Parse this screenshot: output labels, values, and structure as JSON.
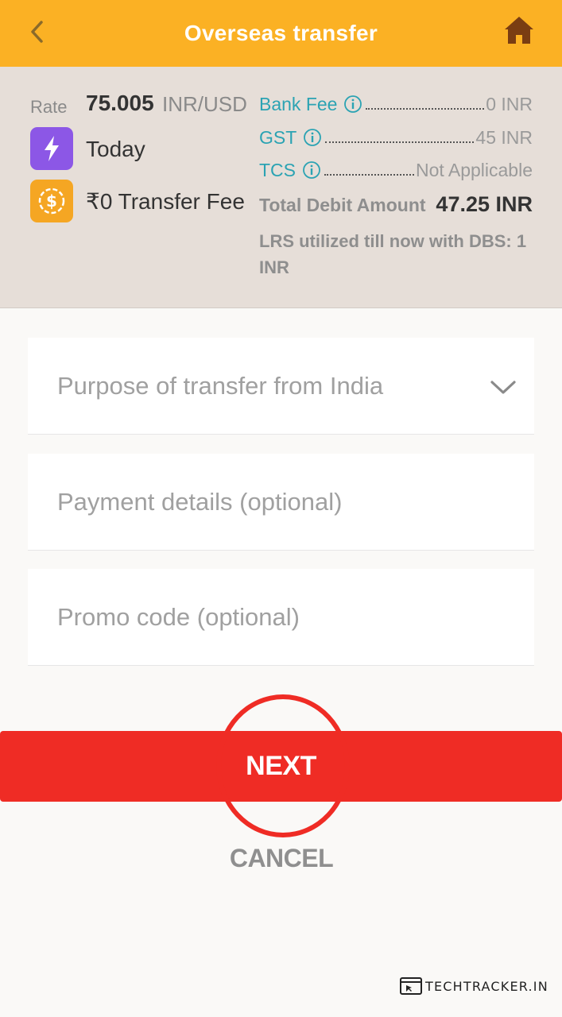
{
  "header": {
    "title": "Overseas transfer",
    "back_icon": "chevron-left-icon",
    "home_icon": "home-icon"
  },
  "summary": {
    "rate_label": "Rate",
    "rate_value": "75.005",
    "rate_unit": "INR/USD",
    "speed_icon": "lightning-bolt-icon",
    "speed_text": "Today",
    "fee_icon": "dollar-coin-icon",
    "transfer_fee_text": "₹0 Transfer Fee",
    "fees": [
      {
        "name": "Bank Fee",
        "value": "0 INR"
      },
      {
        "name": "GST",
        "value": "45 INR"
      },
      {
        "name": "TCS",
        "value": "Not Applicable"
      }
    ],
    "total_label": "Total Debit Amount",
    "total_value": "47.25 INR",
    "lrs_text": "LRS utilized till now with DBS: 1 INR"
  },
  "form": {
    "purpose_placeholder": "Purpose of transfer from India",
    "payment_placeholder": "Payment details (optional)",
    "promo_placeholder": "Promo code (optional)"
  },
  "actions": {
    "next_label": "NEXT",
    "cancel_label": "CANCEL"
  },
  "watermark": {
    "text": "TECHTRACKER.IN"
  },
  "colors": {
    "header": "#fbb124",
    "accent_red": "#ef2c25",
    "teal": "#2ba3b3",
    "purple": "#8c57e6",
    "orange": "#f5a623"
  }
}
